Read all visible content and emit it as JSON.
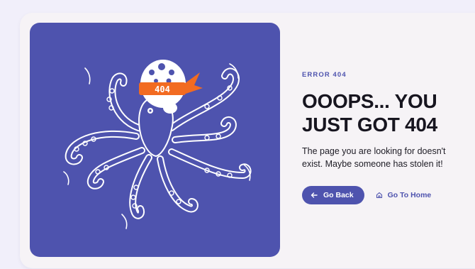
{
  "error": {
    "eyebrow": "ERROR 404",
    "headline": "OOOPS... YOU JUST GOT 404",
    "message": "The page you are looking for doesn't exist. Maybe someone has stolen it!",
    "bandana_text": "404"
  },
  "actions": {
    "back_label": "Go Back",
    "back_icon": "arrow-left-icon",
    "home_label": "Go To Home",
    "home_icon": "home-icon"
  },
  "colors": {
    "accent": "#4e53ae",
    "bandana": "#f26b21",
    "page_bg": "#f1effa",
    "card_bg": "#f6f3f6",
    "headline": "#17151f"
  }
}
